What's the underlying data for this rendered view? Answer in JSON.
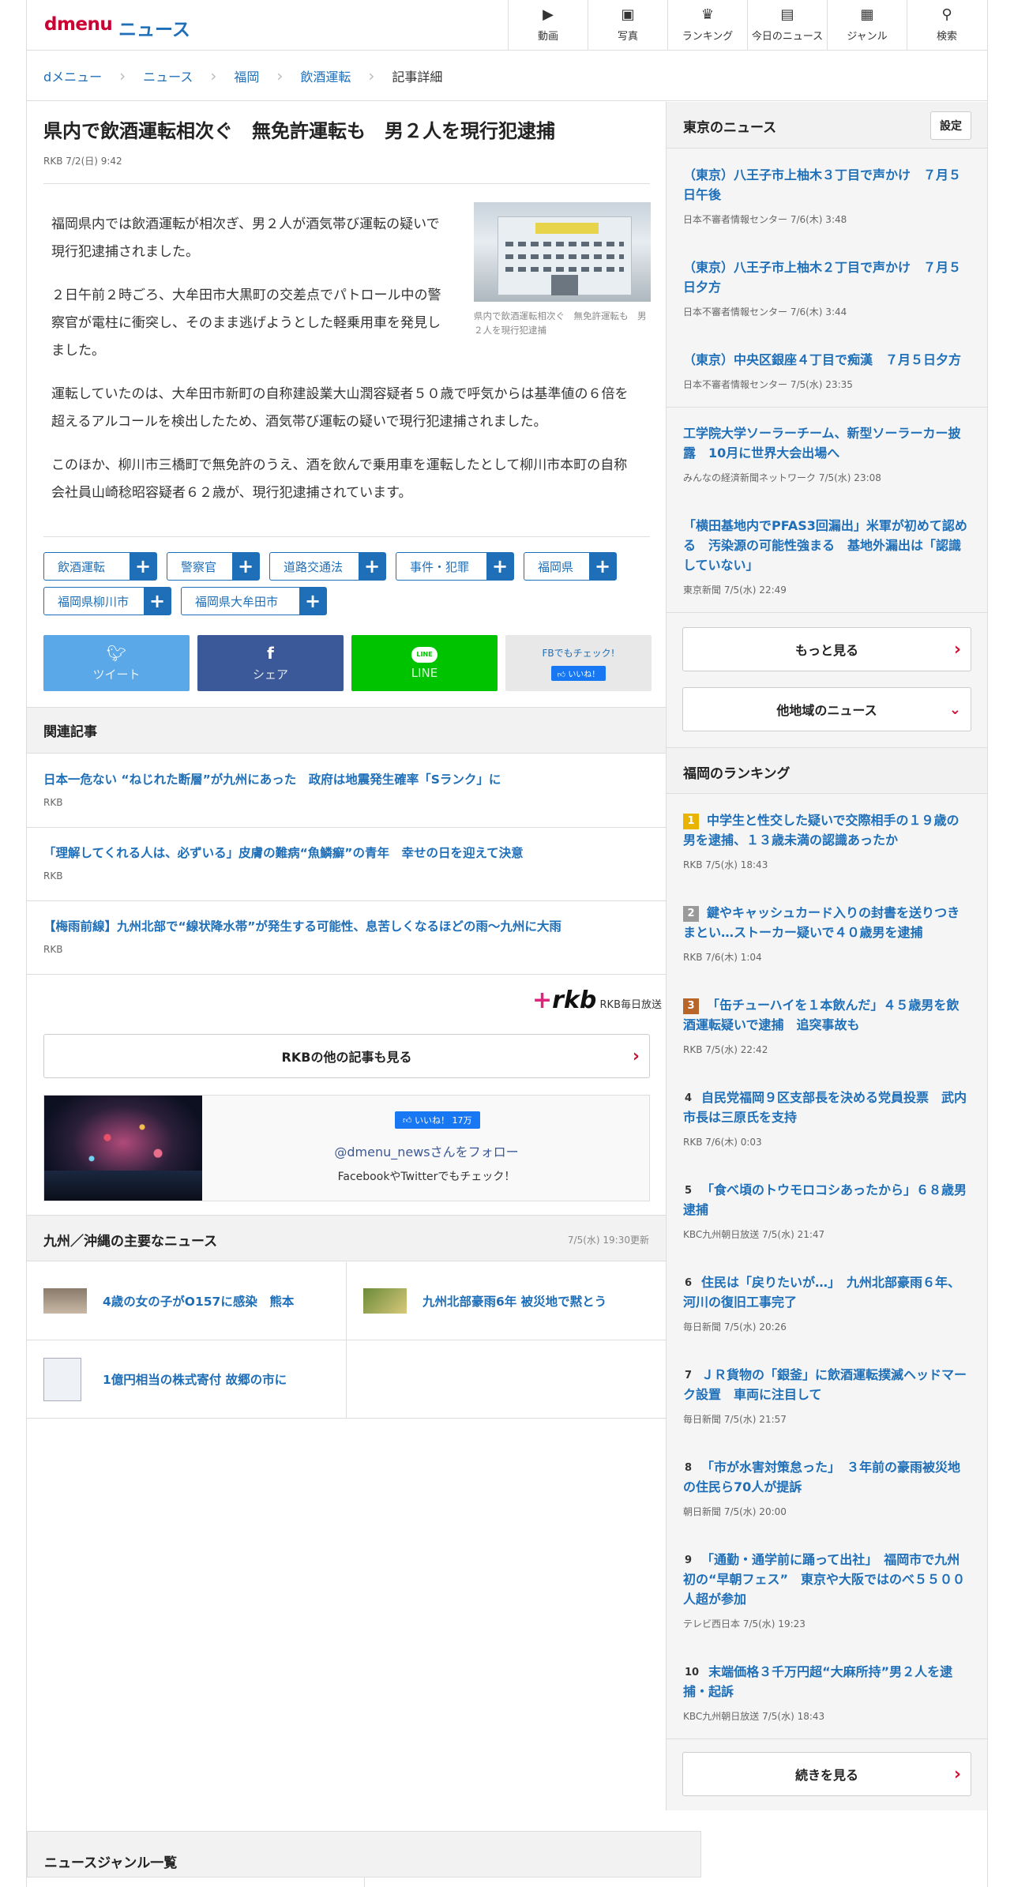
{
  "header": {
    "logo": "dmenu",
    "section": "ニュース",
    "nav": [
      {
        "icon": "▶",
        "label": "動画",
        "name": "video-icon"
      },
      {
        "icon": "▣",
        "label": "写真",
        "name": "photo-icon"
      },
      {
        "icon": "♛",
        "label": "ランキング",
        "name": "ranking-icon"
      },
      {
        "icon": "▤",
        "label": "今日のニュース",
        "name": "today-news-icon"
      },
      {
        "icon": "▦",
        "label": "ジャンル",
        "name": "genre-icon"
      },
      {
        "icon": "⚲",
        "label": "検索",
        "name": "search-icon"
      }
    ]
  },
  "breadcrumb": [
    "dメニュー",
    "ニュース",
    "福岡",
    "飲酒運転",
    "記事詳細"
  ],
  "article": {
    "title": "県内で飲酒運転相次ぐ　無免許運転も　男２人を現行犯逮捕",
    "meta": "RKB 7/2(日) 9:42",
    "paragraphs": [
      "福岡県内では飲酒運転が相次ぎ、男２人が酒気帯び運転の疑いで現行犯逮捕されました。",
      "２日午前２時ごろ、大牟田市大黒町の交差点でパトロール中の警察官が電柱に衝突し、そのまま逃げようとした軽乗用車を発見しました。",
      "運転していたのは、大牟田市新町の自称建設業大山潤容疑者５０歳で呼気からは基準値の６倍を超えるアルコールを検出したため、酒気帯び運転の疑いで現行犯逮捕されました。",
      "このほか、柳川市三橋町で無免許のうえ、酒を飲んで乗用車を運転したとして柳川市本町の自称会社員山崎稔昭容疑者６２歳が、現行犯逮捕されています。"
    ],
    "photo_caption": "県内で飲酒運転相次ぐ　無免許運転も　男２人を現行犯逮捕",
    "tags": [
      "飲酒運転",
      "警察官",
      "道路交通法",
      "事件・犯罪",
      "福岡県",
      "福岡県柳川市",
      "福岡県大牟田市"
    ],
    "share": {
      "tweet": "ツイート",
      "share": "シェア",
      "line": "LINE",
      "fb_check": "FBでもチェック!",
      "fb_like": "いいね！"
    }
  },
  "related": {
    "heading": "関連記事",
    "items": [
      {
        "title": "日本一危ない “ねじれた断層”が九州にあった　政府は地震発生確率「Sランク」に",
        "source": "RKB"
      },
      {
        "title": "「理解してくれる人は、必ずいる」皮膚の難病“魚鱗癬”の青年　幸せの日を迎えて決意",
        "source": "RKB"
      },
      {
        "title": "【梅雨前線】九州北部で“線状降水帯”が発生する可能性、息苦しくなるほどの雨〜九州に大雨",
        "source": "RKB"
      }
    ]
  },
  "publisher": {
    "logo": "rkb",
    "name": "RKB毎日放送",
    "more": "RKBの他の記事も見る"
  },
  "follow": {
    "like": "いいね！ 17万",
    "handle": "@dmenu_newsさんをフォロー",
    "sub": "FacebookやTwitterでもチェック！"
  },
  "kyushu": {
    "heading": "九州／沖縄の主要なニュース",
    "updated": "7/5(水) 19:30更新",
    "items": [
      "4歳の女の子がO157に感染　熊本",
      "九州北部豪雨6年 被災地で黙とう",
      "1億円相当の株式寄付 故郷の市に"
    ]
  },
  "sidebar": {
    "tokyo": {
      "heading": "東京のニュース",
      "settings": "設定",
      "items": [
        {
          "title": "（東京）八王子市上柚木３丁目で声かけ　７月５日午後",
          "source": "日本不審者情報センター 7/6(木) 3:48"
        },
        {
          "title": "（東京）八王子市上柚木２丁目で声かけ　７月５日夕方",
          "source": "日本不審者情報センター 7/6(木) 3:44"
        },
        {
          "title": "（東京）中央区銀座４丁目で痴漢　７月５日夕方",
          "source": "日本不審者情報センター 7/5(水) 23:35"
        },
        {
          "title": "工学院大学ソーラーチーム、新型ソーラーカー披露　10月に世界大会出場へ",
          "source": "みんなの経済新聞ネットワーク 7/5(水) 23:08"
        },
        {
          "title": "「横田基地内でPFAS3回漏出」米軍が初めて認める　汚染源の可能性強まる　基地外漏出は「認識していない」",
          "source": "東京新聞 7/5(水) 22:49"
        }
      ],
      "more": "もっと見る",
      "other": "他地域のニュース"
    },
    "ranking": {
      "heading": "福岡のランキング",
      "items": [
        {
          "rank": "1",
          "color": "#e8b400",
          "title": "中学生と性交した疑いで交際相手の１９歳の男を逮捕、１３歳未満の認識あったか",
          "source": "RKB 7/5(水) 18:43"
        },
        {
          "rank": "2",
          "color": "#9a9a9a",
          "title": "鍵やキャッシュカード入りの封書を送りつきまとい…ストーカー疑いで４０歳男を逮捕",
          "source": "RKB 7/6(木) 1:04"
        },
        {
          "rank": "3",
          "color": "#b8652a",
          "title": "「缶チューハイを１本飲んだ」４５歳男を飲酒運転疑いで逮捕　追突事故も",
          "source": "RKB 7/5(水) 22:42"
        },
        {
          "rank": "4",
          "color": "#f5f5f5",
          "title": "自民党福岡９区支部長を決める党員投票　武内市長は三原氏を支持",
          "source": "RKB 7/6(木) 0:03"
        },
        {
          "rank": "5",
          "color": "#f5f5f5",
          "title": "「食べ頃のトウモロコシあったから」６８歳男逮捕",
          "source": "KBC九州朝日放送 7/5(水) 21:47"
        },
        {
          "rank": "6",
          "color": "#f5f5f5",
          "title": "住民は「戻りたいが…」　九州北部豪雨６年、河川の復旧工事完了",
          "source": "毎日新聞 7/5(水) 20:26"
        },
        {
          "rank": "7",
          "color": "#f5f5f5",
          "title": "ＪＲ貨物の「銀釜」に飲酒運転撲滅ヘッドマーク設置　車両に注目して",
          "source": "毎日新聞 7/5(水) 21:57"
        },
        {
          "rank": "8",
          "color": "#f5f5f5",
          "title": "「市が水害対策怠った」　３年前の豪雨被災地の住民ら70人が提訴",
          "source": "朝日新聞 7/5(水) 20:00"
        },
        {
          "rank": "9",
          "color": "#f5f5f5",
          "title": "「通勤・通学前に踊って出社」　福岡市で九州初の“早朝フェス”　東京や大阪ではのべ５５００人超が参加",
          "source": "テレビ西日本 7/5(水) 19:23"
        },
        {
          "rank": "10",
          "color": "#f5f5f5",
          "title": "末端価格３千万円超“大麻所持”男２人を逮捕・起訴",
          "source": "KBC九州朝日放送 7/5(水) 18:43"
        }
      ],
      "more": "続きを見る"
    }
  },
  "genre": {
    "heading": "ニュースジャンル一覧"
  }
}
